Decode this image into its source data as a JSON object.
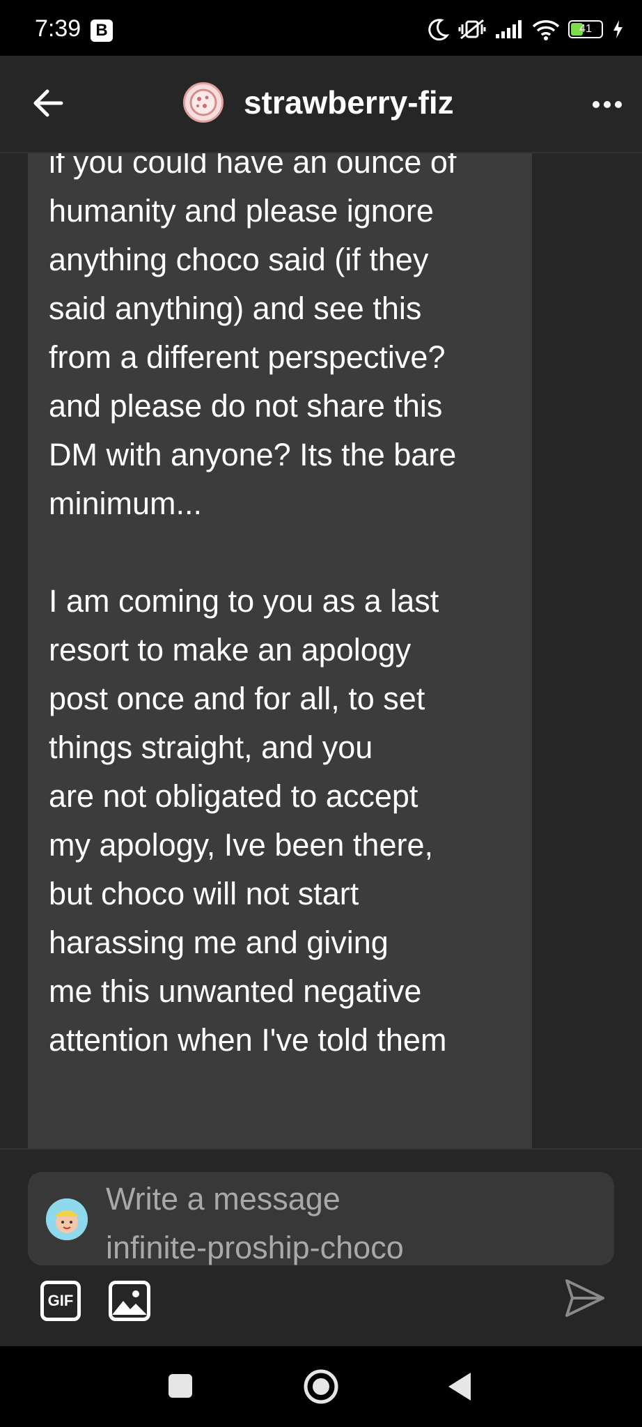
{
  "status_bar": {
    "time": "7:39",
    "badge": "B",
    "battery_percent": "41",
    "battery_level": 0.41
  },
  "header": {
    "title": "strawberry-fiz"
  },
  "message": {
    "text": "if you could have an ounce of\nhumanity and please ignore\nanything choco said (if they\nsaid anything) and see this\nfrom a different perspective?\nand please do not share this\nDM with anyone? Its the bare\nminimum...\n\nI am coming to you as a last\nresort to make an apology\npost once and for all, to set\nthings straight, and you\nare not obligated to accept\nmy apology, Ive been there,\nbut choco will not start\nharassing me and giving\nme this unwanted negative\nattention when I've told them"
  },
  "composer": {
    "placeholder_line1": "Write a message",
    "placeholder_line2": "infinite-proship-choco",
    "gif_label": "GIF"
  },
  "colors": {
    "background": "#262626",
    "bubble": "#3c3c3c",
    "input": "#383838",
    "battery": "#7ddc4b"
  }
}
